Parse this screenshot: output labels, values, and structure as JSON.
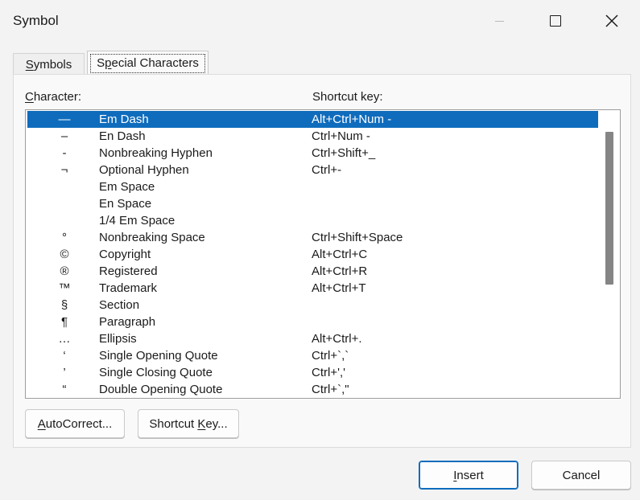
{
  "window": {
    "title": "Symbol"
  },
  "tabs": [
    {
      "label": "Symbols",
      "selected": false
    },
    {
      "label": "Special Characters",
      "selected": true
    }
  ],
  "headers": {
    "character": "Character:",
    "shortcut": "Shortcut key:"
  },
  "rows": [
    {
      "glyph": "—",
      "name": "Em Dash",
      "key": "Alt+Ctrl+Num -",
      "selected": true
    },
    {
      "glyph": "–",
      "name": "En Dash",
      "key": "Ctrl+Num -"
    },
    {
      "glyph": "‑",
      "name": "Nonbreaking Hyphen",
      "key": "Ctrl+Shift+_"
    },
    {
      "glyph": "¬",
      "name": "Optional Hyphen",
      "key": "Ctrl+-"
    },
    {
      "glyph": "",
      "name": "Em Space",
      "key": ""
    },
    {
      "glyph": "",
      "name": "En Space",
      "key": ""
    },
    {
      "glyph": "",
      "name": "1/4 Em Space",
      "key": ""
    },
    {
      "glyph": "°",
      "name": "Nonbreaking Space",
      "key": "Ctrl+Shift+Space"
    },
    {
      "glyph": "©",
      "name": "Copyright",
      "key": "Alt+Ctrl+C"
    },
    {
      "glyph": "®",
      "name": "Registered",
      "key": "Alt+Ctrl+R"
    },
    {
      "glyph": "™",
      "name": "Trademark",
      "key": "Alt+Ctrl+T"
    },
    {
      "glyph": "§",
      "name": "Section",
      "key": ""
    },
    {
      "glyph": "¶",
      "name": "Paragraph",
      "key": ""
    },
    {
      "glyph": "…",
      "name": "Ellipsis",
      "key": "Alt+Ctrl+."
    },
    {
      "glyph": "‘",
      "name": "Single Opening Quote",
      "key": "Ctrl+`,`"
    },
    {
      "glyph": "’",
      "name": "Single Closing Quote",
      "key": "Ctrl+','"
    },
    {
      "glyph": "“",
      "name": "Double Opening Quote",
      "key": "Ctrl+`,\""
    }
  ],
  "buttons": {
    "autocorrect": "AutoCorrect...",
    "shortcut_key": "Shortcut Key...",
    "insert": "Insert",
    "cancel": "Cancel"
  },
  "icons": {
    "minimize": "minimize-icon",
    "maximize": "maximize-icon",
    "close": "close-icon"
  },
  "colors": {
    "selection": "#0f6cbd",
    "background": "#f3f3f3"
  }
}
